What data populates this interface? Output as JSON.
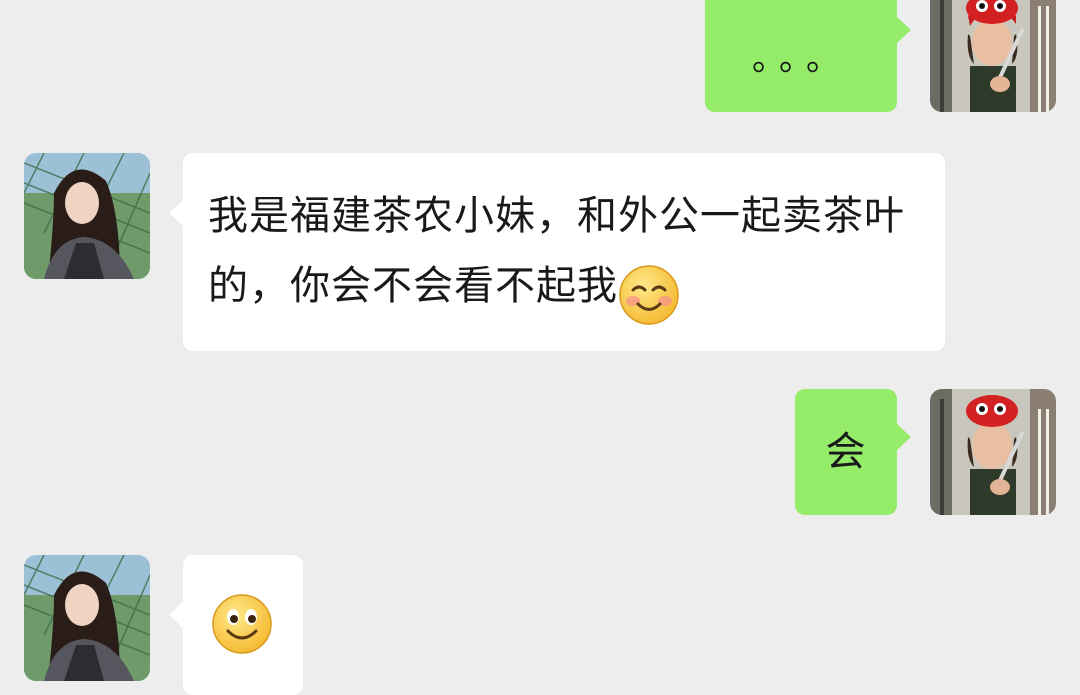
{
  "chat": {
    "messages": [
      {
        "sender": "me",
        "type": "text",
        "text": "。。。"
      },
      {
        "sender": "contact",
        "type": "text",
        "text": "我是福建茶农小妹，和外公一起卖茶叶的，你会不会看不起我",
        "emoji": "blush-smile-emoji"
      },
      {
        "sender": "me",
        "type": "text",
        "text": "会"
      },
      {
        "sender": "contact",
        "type": "emoji",
        "emoji": "smile-emoji"
      }
    ]
  },
  "colors": {
    "background": "#ededed",
    "incoming_bubble": "#ffffff",
    "outgoing_bubble": "#95ec69",
    "text": "#191919"
  }
}
